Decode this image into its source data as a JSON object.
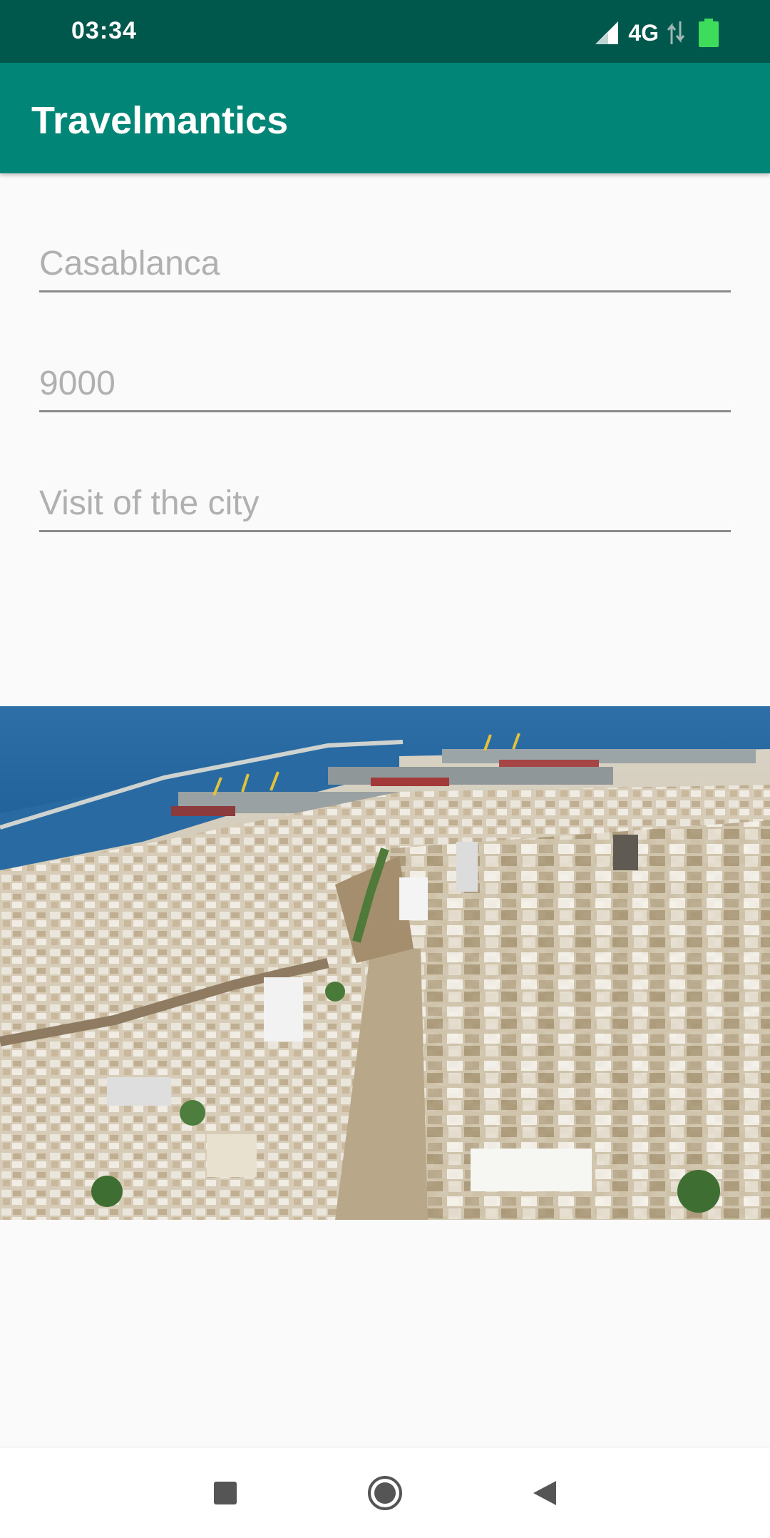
{
  "status_bar": {
    "time": "03:34",
    "network": "4G",
    "icons": [
      "signal-icon",
      "data-arrows-icon",
      "battery-icon"
    ]
  },
  "app_bar": {
    "title": "Travelmantics",
    "color": "#008577",
    "status_color": "#00574b"
  },
  "form": {
    "title_placeholder": "Casablanca",
    "price_placeholder": "9000",
    "description_placeholder": "Visit of the city"
  },
  "photo": {
    "subject": "aerial-city-port-photo"
  },
  "nav_bar": {
    "icons": [
      "recents-icon",
      "home-icon",
      "back-icon"
    ]
  }
}
